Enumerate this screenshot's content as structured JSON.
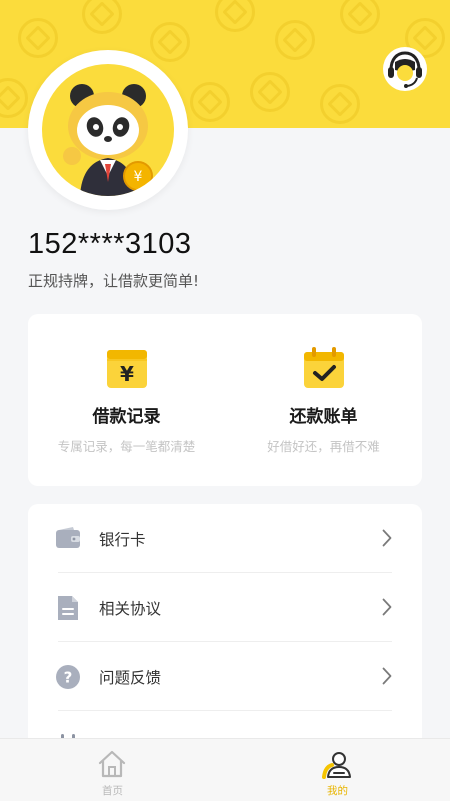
{
  "profile": {
    "phone": "152****3103",
    "slogan": "正规持牌，让借款更简单!"
  },
  "quick_actions": [
    {
      "title": "借款记录",
      "subtitle": "专属记录，每一笔都清楚",
      "icon": "yuan-box-icon"
    },
    {
      "title": "还款账单",
      "subtitle": "好借好还，再借不难",
      "icon": "calendar-check-icon"
    }
  ],
  "menu": [
    {
      "label": "银行卡",
      "icon": "wallet-icon"
    },
    {
      "label": "相关协议",
      "icon": "document-icon"
    },
    {
      "label": "问题反馈",
      "icon": "question-icon"
    }
  ],
  "tabs": [
    {
      "label": "首页",
      "icon": "home-icon",
      "active": false
    },
    {
      "label": "我的",
      "icon": "user-icon",
      "active": true
    }
  ],
  "colors": {
    "brand_yellow": "#fbdc3c",
    "active_tab": "#e8b500",
    "inactive_tab": "#b8b8b8",
    "background": "#f5f6f8"
  }
}
